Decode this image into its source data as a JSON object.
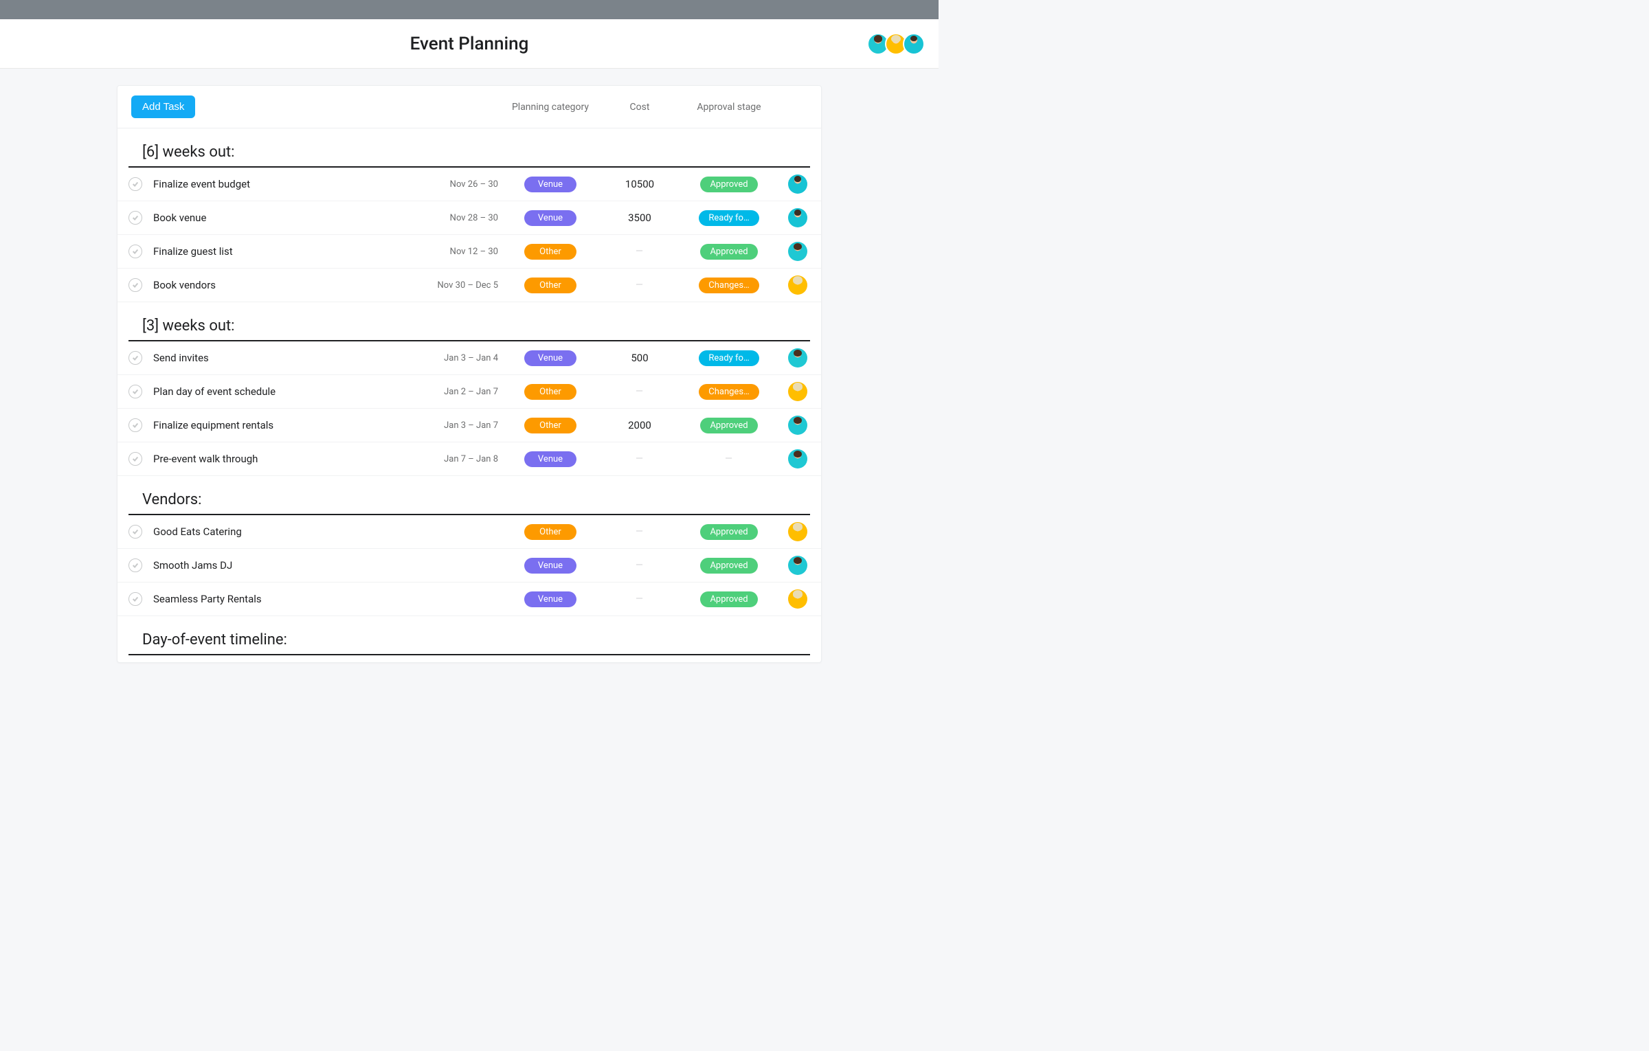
{
  "header": {
    "title": "Event Planning",
    "avatars": [
      "teal",
      "yellow",
      "cyan"
    ]
  },
  "toolbar": {
    "add_task_label": "Add Task",
    "columns": {
      "planning": "Planning category",
      "cost": "Cost",
      "approval": "Approval stage"
    }
  },
  "pill_labels": {
    "venue": "Venue",
    "other": "Other",
    "approved": "Approved",
    "ready": "Ready fo…",
    "changes": "Changes…"
  },
  "sections": [
    {
      "title": "[6] weeks out:",
      "tasks": [
        {
          "name": "Finalize event budget",
          "date": "Nov 26 – 30",
          "category": "venue",
          "cost": "10500",
          "approval": "approved",
          "avatar": "cyan"
        },
        {
          "name": "Book venue",
          "date": "Nov 28 – 30",
          "category": "venue",
          "cost": "3500",
          "approval": "ready",
          "avatar": "cyan"
        },
        {
          "name": "Finalize guest list",
          "date": "Nov 12 – 30",
          "category": "other",
          "cost": "",
          "approval": "approved",
          "avatar": "teal"
        },
        {
          "name": "Book vendors",
          "date": "Nov 30 – Dec 5",
          "category": "other",
          "cost": "",
          "approval": "changes",
          "avatar": "yellow"
        }
      ]
    },
    {
      "title": "[3] weeks out:",
      "tasks": [
        {
          "name": "Send invites",
          "date": "Jan 3 – Jan 4",
          "category": "venue",
          "cost": "500",
          "approval": "ready",
          "avatar": "teal"
        },
        {
          "name": "Plan day of event schedule",
          "date": "Jan 2 – Jan 7",
          "category": "other",
          "cost": "",
          "approval": "changes",
          "avatar": "yellow"
        },
        {
          "name": "Finalize equipment rentals",
          "date": "Jan 3 – Jan 7",
          "category": "other",
          "cost": "2000",
          "approval": "approved",
          "avatar": "teal"
        },
        {
          "name": "Pre-event walk through",
          "date": "Jan 7 – Jan 8",
          "category": "venue",
          "cost": "",
          "approval": "",
          "avatar": "teal"
        }
      ]
    },
    {
      "title": "Vendors:",
      "tasks": [
        {
          "name": "Good Eats Catering",
          "date": "",
          "category": "other",
          "cost": "",
          "approval": "approved",
          "avatar": "yellow"
        },
        {
          "name": "Smooth Jams DJ",
          "date": "",
          "category": "venue",
          "cost": "",
          "approval": "approved",
          "avatar": "teal"
        },
        {
          "name": "Seamless Party Rentals",
          "date": "",
          "category": "venue",
          "cost": "",
          "approval": "approved",
          "avatar": "yellow"
        }
      ]
    },
    {
      "title": "Day-of-event timeline:",
      "tasks": []
    }
  ]
}
